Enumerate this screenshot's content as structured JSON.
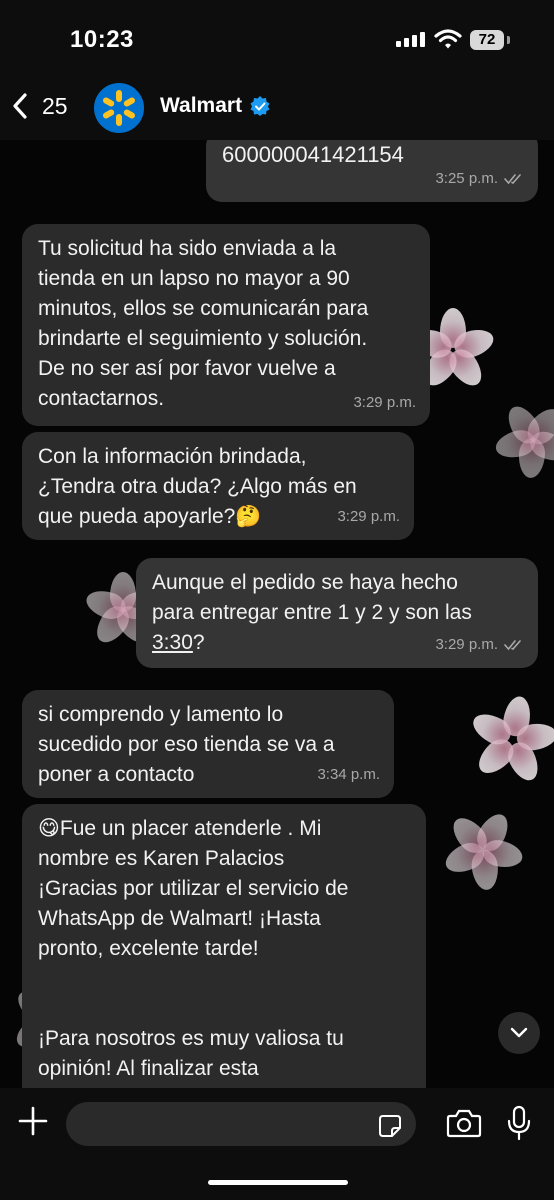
{
  "status": {
    "time": "10:23",
    "battery": "72"
  },
  "header": {
    "back_count": "25",
    "contact_name": "Walmart"
  },
  "messages": [
    {
      "direction": "out",
      "lines": [
        "600000041421154"
      ],
      "time": "3:25 p.m."
    },
    {
      "direction": "in",
      "lines": [
        "Tu solicitud ha sido enviada a la",
        "tienda en un lapso no mayor a 90",
        "minutos, ellos se comunicarán para",
        "brindarte el seguimiento y solución.",
        "De no ser así por favor vuelve a",
        "contactarnos."
      ],
      "time": "3:29 p.m."
    },
    {
      "direction": "in",
      "lines": [
        "Con la información brindada,",
        "¿Tendra otra duda? ¿Algo más en",
        "que pueda apoyarle?🤔"
      ],
      "time": "3:29 p.m."
    },
    {
      "direction": "out",
      "lines": [
        "Aunque el pedido se haya hecho",
        "para entregar entre 1 y 2 y son las"
      ],
      "line_last_link": "3:30",
      "line_last_tail": "?",
      "time": "3:29 p.m."
    },
    {
      "direction": "in",
      "lines": [
        "si comprendo y lamento lo",
        "sucedido por eso tienda se va a",
        "poner a contacto"
      ],
      "time": "3:34 p.m."
    },
    {
      "direction": "in",
      "lines": [
        "😋Fue un placer atenderle . Mi",
        "nombre es Karen Palacios",
        "¡Gracias por utilizar el servicio de",
        "WhatsApp de Walmart! ¡Hasta",
        "pronto, excelente tarde!",
        "",
        "",
        "¡Para nosotros es muy valiosa tu",
        "opinión! Al finalizar esta"
      ]
    }
  ],
  "input": {
    "placeholder": ""
  },
  "icons": {
    "back": "chevron-left-icon",
    "verified": "verified-badge-icon",
    "plus": "plus-icon",
    "sticker": "sticker-icon",
    "camera": "camera-icon",
    "mic": "microphone-icon",
    "scroll": "chevron-down-icon",
    "read": "double-check-icon"
  },
  "colors": {
    "brand_blue": "#0071ce",
    "brand_yellow": "#ffc220",
    "verified": "#1d9bf0"
  }
}
